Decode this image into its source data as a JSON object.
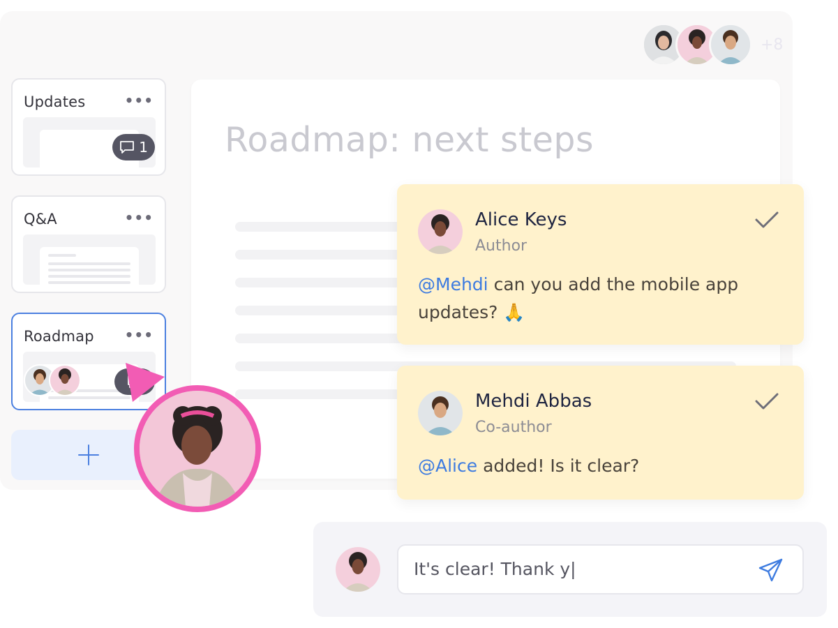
{
  "collaborators": {
    "more_count": "+8"
  },
  "sidebar": {
    "items": [
      {
        "title": "Updates",
        "more": "•••",
        "comment_count": "1"
      },
      {
        "title": "Q&A",
        "more": "•••"
      },
      {
        "title": "Roadmap",
        "more": "•••"
      }
    ]
  },
  "document": {
    "title": "Roadmap: next steps"
  },
  "comments": [
    {
      "name": "Alice Keys",
      "role": "Author",
      "mention": "@Mehdi",
      "text": " can you add the mobile app updates? 🙏"
    },
    {
      "name": "Mehdi Abbas",
      "role": "Co-author",
      "mention": "@Alice",
      "text": " added! Is it clear?"
    }
  ],
  "composer": {
    "value": "It's clear! Thank y|"
  },
  "colors": {
    "accent_blue": "#4a7fe0",
    "mention_blue": "#3d7be0",
    "comment_bg": "#fff2cc",
    "cursor_pink": "#f25cb4"
  }
}
